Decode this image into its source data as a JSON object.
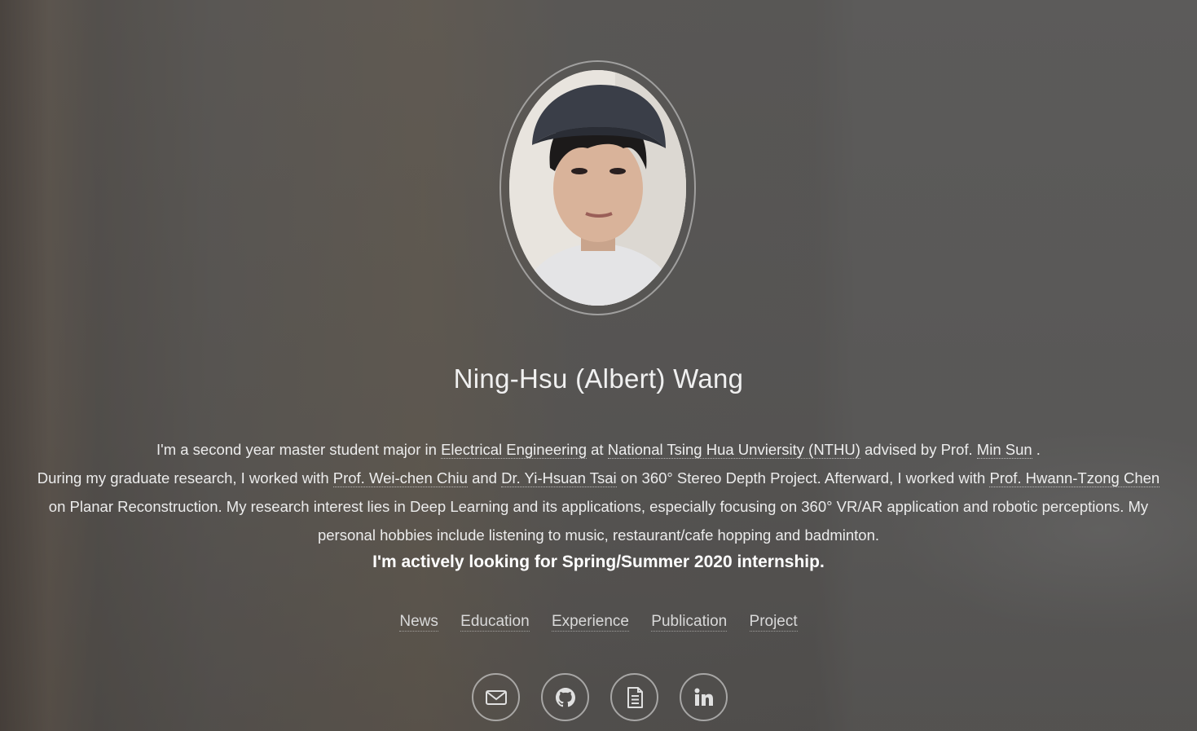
{
  "profile": {
    "name": "Ning-Hsu (Albert) Wang",
    "photo_alt": "profile photo"
  },
  "bio": {
    "line1_pre": "I'm a second year master student major in ",
    "link_ee": "Electrical Engineering",
    "line1_at": " at ",
    "link_nthu": "National Tsing Hua Unviersity (NTHU)",
    "line1_adv": " advised by Prof. ",
    "link_minsun": "Min Sun",
    "line1_end": " .",
    "p2_pre": "During my graduate research, I worked with ",
    "link_chiu": "Prof. Wei-chen Chiu",
    "p2_and": " and ",
    "link_tsai": "Dr. Yi-Hsuan Tsai",
    "p2_mid": " on 360° Stereo Depth Project. Afterward, I worked with ",
    "link_chen": "Prof. Hwann-Tzong Chen",
    "p2_rest": " on Planar Reconstruction. My research interest lies in Deep Learning and its applications, especially focusing on 360° VR/AR application and robotic perceptions. My personal hobbies include listening to music, restaurant/cafe hopping and badminton."
  },
  "callout": "I'm actively looking for Spring/Summer 2020 internship.",
  "nav": {
    "news": "News",
    "education": "Education",
    "experience": "Experience",
    "publication": "Publication",
    "project": "Project"
  },
  "social": [
    {
      "icon": "envelope-icon"
    },
    {
      "icon": "github-icon"
    },
    {
      "icon": "document-icon"
    },
    {
      "icon": "linkedin-icon"
    }
  ]
}
